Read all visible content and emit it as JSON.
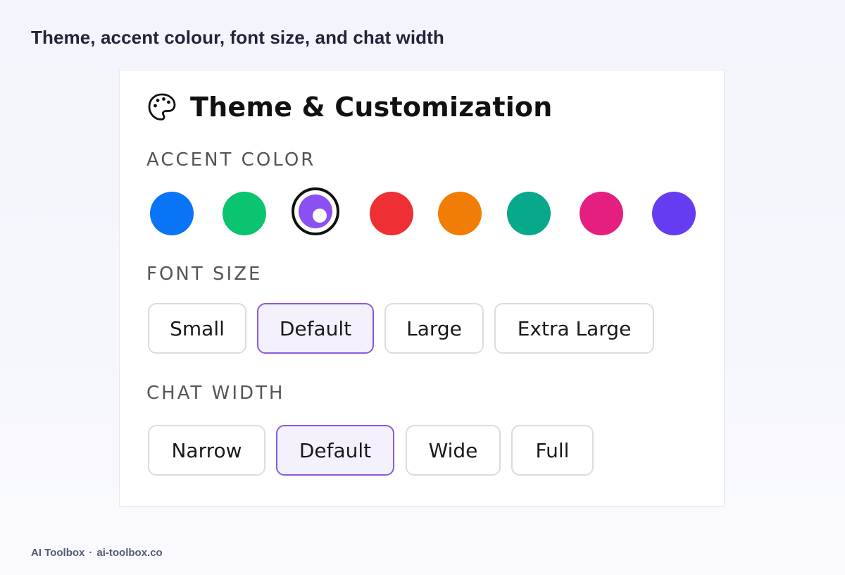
{
  "caption": "Theme, accent colour, font size, and chat width",
  "card": {
    "title": "Theme & Customization",
    "icon": "palette-icon"
  },
  "accent": {
    "label": "ACCENT COLOR",
    "selected_index": 2,
    "colors": [
      {
        "name": "blue",
        "hex": "#0a74f7"
      },
      {
        "name": "green",
        "hex": "#0bc46f"
      },
      {
        "name": "purple",
        "hex": "#8b50f1"
      },
      {
        "name": "red",
        "hex": "#ee3034"
      },
      {
        "name": "orange",
        "hex": "#f17d06"
      },
      {
        "name": "teal",
        "hex": "#08a88b"
      },
      {
        "name": "pink",
        "hex": "#e41f7f"
      },
      {
        "name": "indigo",
        "hex": "#653cf2"
      }
    ]
  },
  "font_size": {
    "label": "FONT SIZE",
    "selected": "Default",
    "options": [
      "Small",
      "Default",
      "Large",
      "Extra Large"
    ]
  },
  "chat_width": {
    "label": "CHAT WIDTH",
    "selected": "Default",
    "options": [
      "Narrow",
      "Default",
      "Wide",
      "Full"
    ]
  },
  "footer": {
    "brand": "AI Toolbox",
    "separator": "·",
    "site": "ai-toolbox.co"
  }
}
